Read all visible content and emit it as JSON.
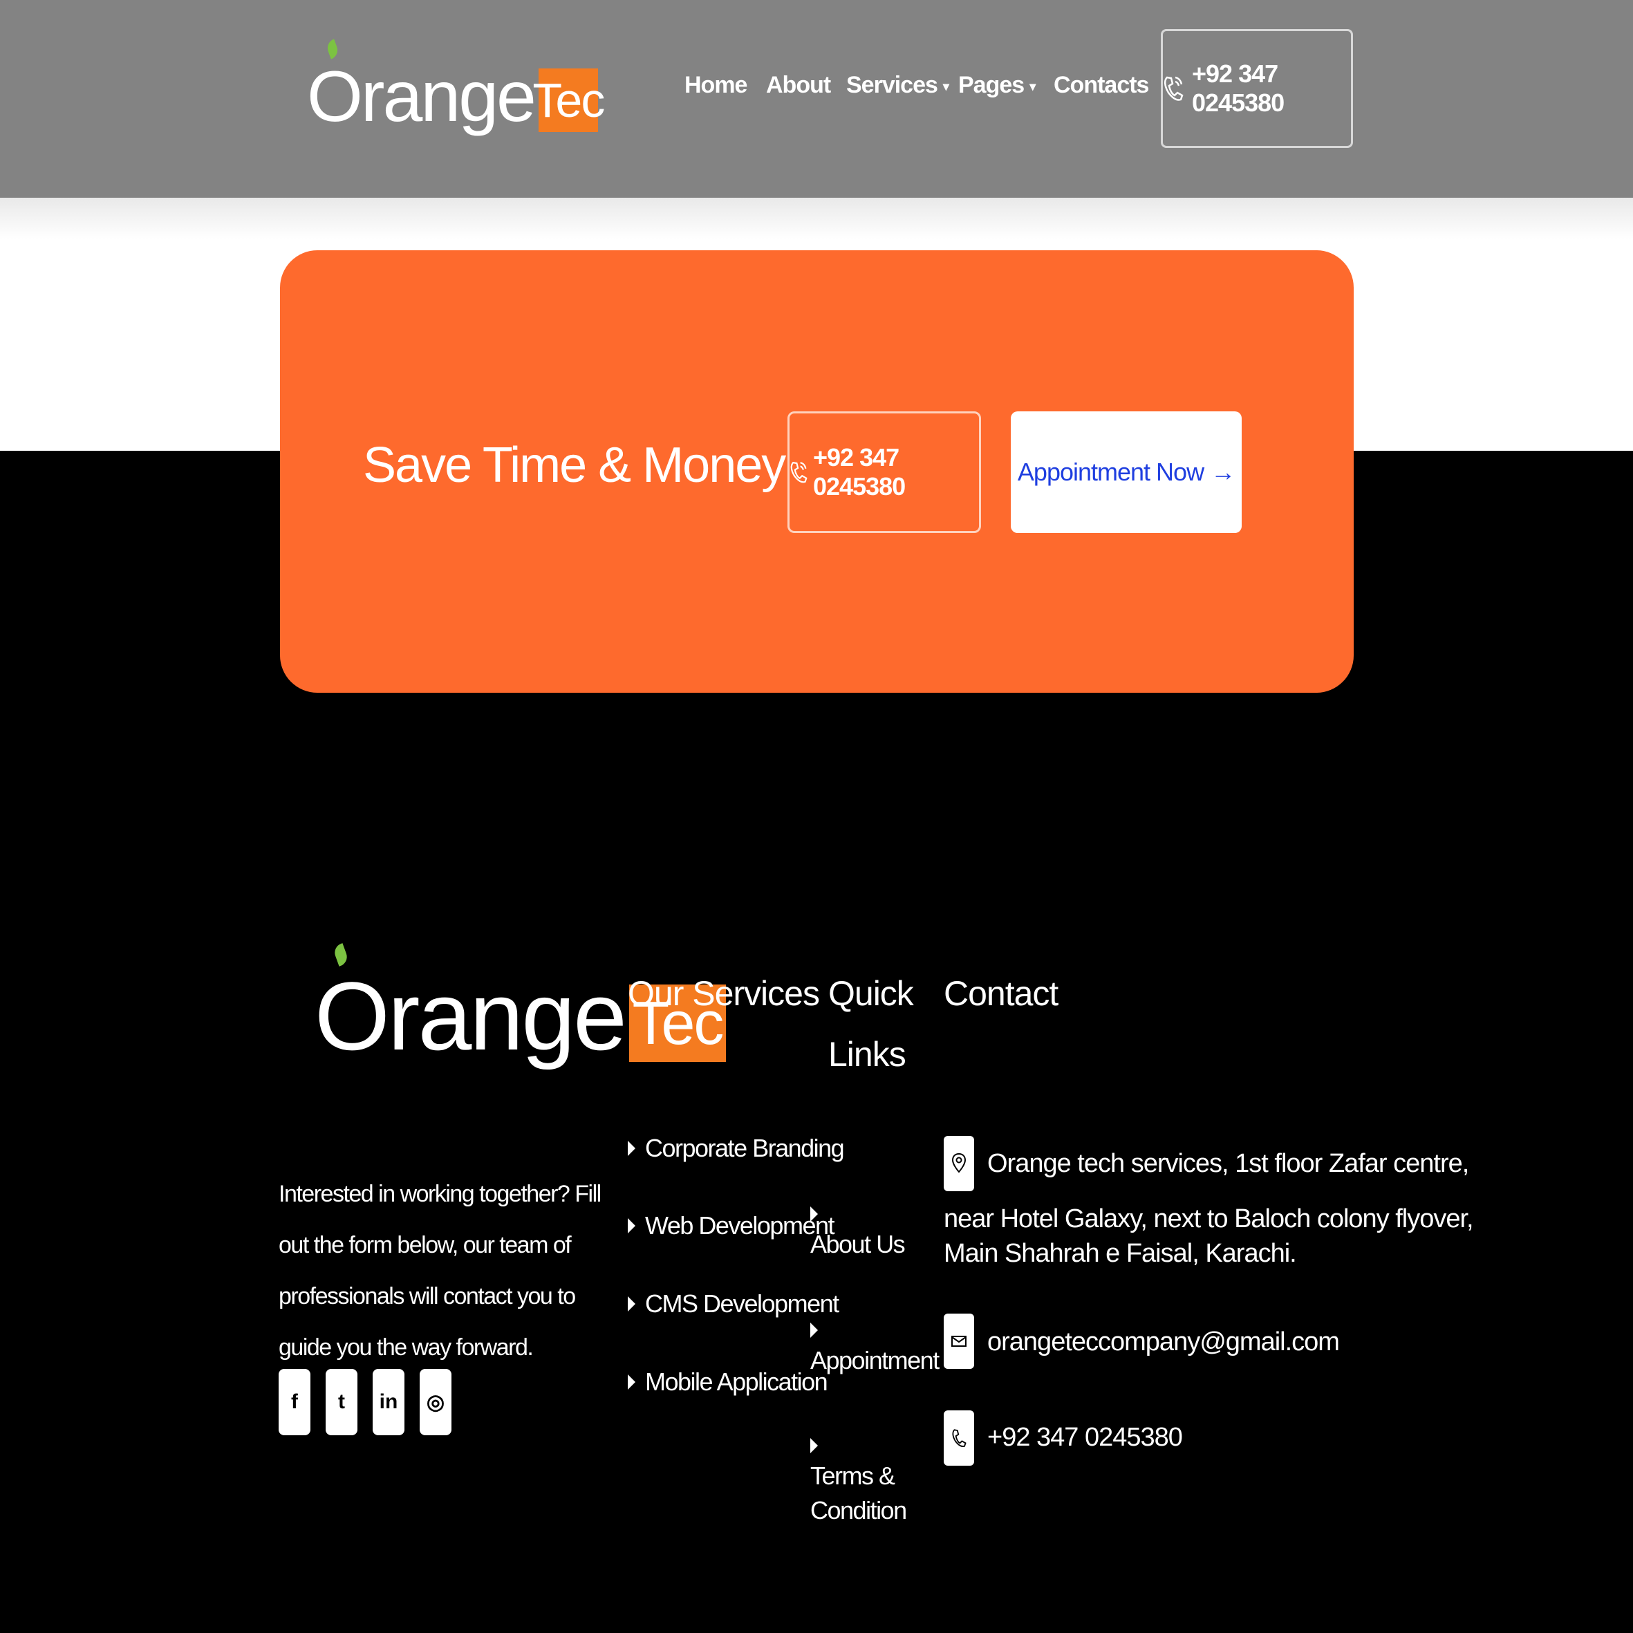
{
  "brand": {
    "logo_word": "Orange",
    "logo_tec": "Tec"
  },
  "header": {
    "nav": [
      {
        "label": "Home",
        "caret": false
      },
      {
        "label": "About",
        "caret": false
      },
      {
        "label": "Services",
        "caret": true
      },
      {
        "label": "Pages",
        "caret": true
      },
      {
        "label": "Contacts",
        "caret": false
      }
    ],
    "phone": "+92 347 0245380"
  },
  "cta": {
    "title": "Save Time & Money",
    "phone": "+92 347 0245380",
    "appointment": "Appointment Now",
    "appointment_arrow": "→"
  },
  "footer": {
    "description": "Interested in working together? Fill out the form below, our team of professionals will contact you to guide you the way forward.",
    "socials": [
      {
        "icon": "facebook-icon",
        "glyph": "f"
      },
      {
        "icon": "twitter-icon",
        "glyph": "t"
      },
      {
        "icon": "linkedin-icon",
        "glyph": "in"
      },
      {
        "icon": "instagram-icon",
        "glyph": "◎"
      }
    ],
    "services_heading": "Our Services",
    "services": [
      "Corporate Branding",
      "Web Development",
      "CMS Development",
      "Mobile Application"
    ],
    "quick_heading_1": "Quick",
    "quick_heading_2": "Links",
    "quick_links": [
      "About Us",
      "Appointment",
      "Terms & Condition"
    ],
    "contact_heading": "Contact",
    "address_line1": "Orange tech services, 1st floor Zafar centre,",
    "address_line2": "near Hotel Galaxy, next to Baloch colony flyover,",
    "address_line3": "Main Shahrah e Faisal, Karachi.",
    "email": "orangeteccompany@gmail.com",
    "phone": "+92 347 0245380"
  },
  "colors": {
    "header_bg": "#838383",
    "accent_orange": "#fe6a2d",
    "logo_orange": "#f47b20",
    "leaf_green": "#7cc242",
    "appointment_blue": "#1f3fe0",
    "footer_bg": "#000000"
  }
}
